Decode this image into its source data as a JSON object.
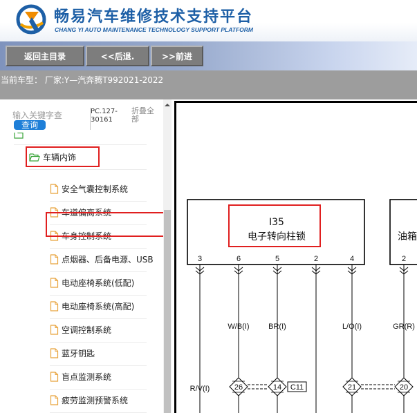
{
  "header": {
    "title": "畅易汽车维修技术支持平台",
    "subtitle": "CHANG YI AUTO MAINTENANCE TECHNOLOGY SUPPORT PLATFORM",
    "logo_icon": "cy-logo-icon"
  },
  "toolbar": {
    "home_label": "返回主目录",
    "back_label": "<<后退.",
    "forward_label": ">>前进"
  },
  "vehicle": {
    "text": "当前车型： 厂家:Y—汽奔腾T992021-2022"
  },
  "sidebar": {
    "search_placeholder": "输入关键字查",
    "search_button": "查询",
    "pc_code": "PC.127-30161",
    "collapse_all": "折叠全部",
    "partial_item": "",
    "folder_label": "车辆内饰",
    "items": [
      {
        "label": "安全气囊控制系统"
      },
      {
        "label": "车道偏离系统"
      },
      {
        "label": "车身控制系统"
      },
      {
        "label": "点烟器、后备电源、USB"
      },
      {
        "label": "电动座椅系统(低配)"
      },
      {
        "label": "电动座椅系统(高配)"
      },
      {
        "label": "空调控制系统"
      },
      {
        "label": "蓝牙钥匙"
      },
      {
        "label": "盲点监测系统"
      },
      {
        "label": "疲劳监测预警系统"
      }
    ]
  },
  "diagram": {
    "component_id": "I35",
    "component_name": "电子转向柱锁",
    "next_component": "油箱",
    "pins": [
      "3",
      "6",
      "5",
      "2",
      "4",
      "2"
    ],
    "wire_labels": [
      "W/B(I)",
      "BR(I)",
      "L/O(I)",
      "GR(R)",
      "R/V(I)"
    ],
    "connector_nums": [
      "26",
      "14",
      "21",
      "20"
    ],
    "connector_tag": "C11"
  },
  "colors": {
    "brand_blue": "#1d5fa6",
    "highlight_red": "#e01f1f",
    "search_blue": "#1e7fd8",
    "toolbar_button": "#7d7d7d"
  }
}
